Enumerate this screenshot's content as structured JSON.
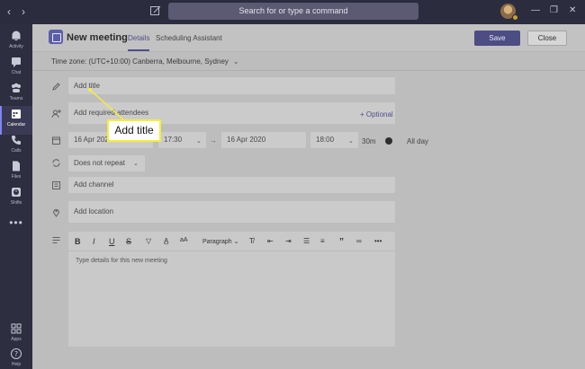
{
  "window": {
    "search_placeholder": "Search for or type a command",
    "icons": [
      "back-icon",
      "forward-icon",
      "compose-icon",
      "avatar",
      "minimize-icon",
      "maximize-icon",
      "close-icon"
    ]
  },
  "app_bar": {
    "items": [
      {
        "label": "Activity",
        "icon": "bell-icon"
      },
      {
        "label": "Chat",
        "icon": "chat-icon"
      },
      {
        "label": "Teams",
        "icon": "teams-icon"
      },
      {
        "label": "Calendar",
        "icon": "calendar-icon",
        "active": true
      },
      {
        "label": "Calls",
        "icon": "phone-icon"
      },
      {
        "label": "Files",
        "icon": "file-icon"
      },
      {
        "label": "Shifts",
        "icon": "shifts-icon"
      },
      {
        "label": "",
        "icon": "more-icon"
      },
      {
        "label": "Apps",
        "icon": "apps-icon"
      },
      {
        "label": "Help",
        "icon": "help-icon"
      }
    ]
  },
  "header": {
    "title": "New meeting",
    "tabs": [
      {
        "label": "Details",
        "active": true
      },
      {
        "label": "Scheduling Assistant",
        "active": false
      }
    ],
    "save_label": "Save",
    "close_label": "Close"
  },
  "timezone": {
    "label": "Time zone: (UTC+10:00) Canberra, Melbourne, Sydney"
  },
  "form": {
    "title_placeholder": "Add title",
    "attendees_placeholder": "Add required attendees",
    "optional_label": "+ Optional",
    "start_date": "16 Apr 2020",
    "start_time": "17:30",
    "end_date": "16 Apr 2020",
    "end_time": "18:00",
    "duration": "30m",
    "all_day_label": "All day",
    "repeat_value": "Does not repeat",
    "channel_placeholder": "Add channel",
    "location_placeholder": "Add location",
    "editor": {
      "paragraph_label": "Paragraph",
      "placeholder": "Type details for this new meeting"
    }
  },
  "callout": {
    "text": "Add title"
  },
  "colors": {
    "accent": "#4e4f8c",
    "titlebar": "#2c2c3f",
    "callout_border": "#f5ee3a"
  }
}
